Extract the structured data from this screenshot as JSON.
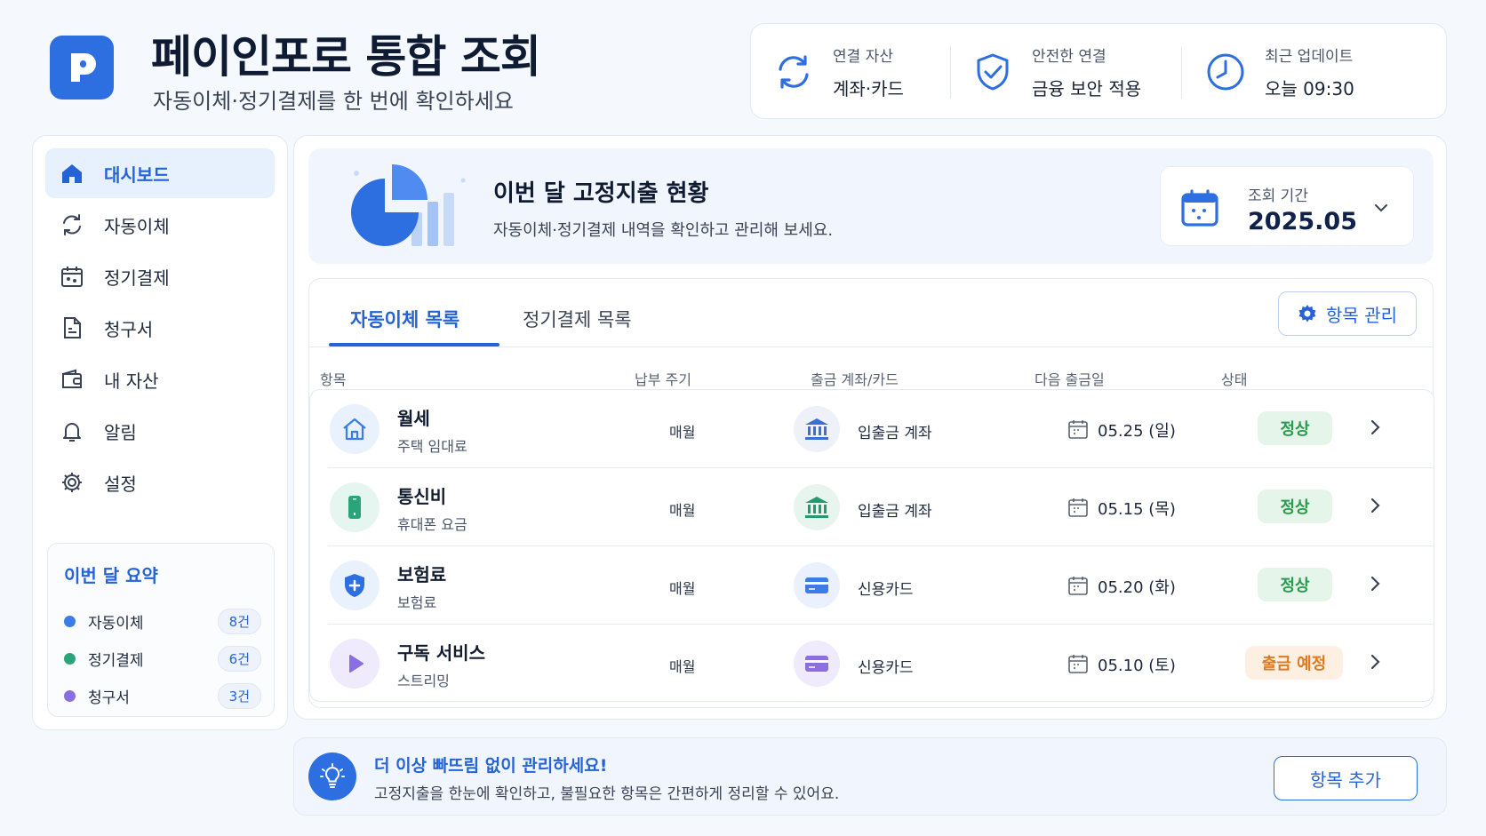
{
  "header": {
    "title": "페이인포로 통합 조회",
    "subtitle": "자동이체·정기결제를 한 번에 확인하세요",
    "logo_letter": "P",
    "stats": [
      {
        "label": "연결 자산",
        "value": "계좌·카드",
        "icon": "sync-icon"
      },
      {
        "label": "안전한 연결",
        "value": "금융 보안 적용",
        "icon": "shield-check-icon"
      },
      {
        "label": "최근 업데이트",
        "value": "오늘 09:30",
        "icon": "clock-icon"
      }
    ]
  },
  "sidebar": {
    "items": [
      {
        "label": "대시보드",
        "icon": "home-icon",
        "active": true
      },
      {
        "label": "자동이체",
        "icon": "refresh-icon"
      },
      {
        "label": "정기결제",
        "icon": "calendar-icon"
      },
      {
        "label": "청구서",
        "icon": "document-icon"
      },
      {
        "label": "내 자산",
        "icon": "wallet-icon"
      },
      {
        "label": "알림",
        "icon": "bell-icon"
      },
      {
        "label": "설정",
        "icon": "gear-icon"
      }
    ],
    "summary": {
      "title": "이번 달 요약",
      "rows": [
        {
          "name": "자동이체",
          "count": "8건",
          "color": "#3b7ce6"
        },
        {
          "name": "정기결제",
          "count": "6건",
          "color": "#2aa57a"
        },
        {
          "name": "청구서",
          "count": "3건",
          "color": "#8b6fe0"
        }
      ]
    }
  },
  "hero": {
    "title": "이번 달 고정지출 현황",
    "desc": "자동이체·정기결제 내역을 확인하고 관리해 보세요.",
    "period_label": "조회 기간",
    "period_value": "2025.05"
  },
  "list": {
    "tabs": [
      "자동이체 목록",
      "정기결제 목록"
    ],
    "manage_label": "항목 관리",
    "columns": [
      "항목",
      "납부 주기",
      "출금 계좌/카드",
      "다음 출금일",
      "상태"
    ],
    "rows": [
      {
        "name": "월세",
        "sub": "주택 임대료",
        "cycle": "매월",
        "account": "입출금 계좌",
        "date": "05.25 (일)",
        "status": "정상",
        "icon": "house-icon",
        "account_icon": "bank-icon"
      },
      {
        "name": "통신비",
        "sub": "휴대폰 요금",
        "cycle": "매월",
        "account": "입출금 계좌",
        "date": "05.15 (목)",
        "status": "정상",
        "icon": "phone-icon",
        "account_icon": "bank-icon"
      },
      {
        "name": "보험료",
        "sub": "보험료",
        "cycle": "매월",
        "account": "신용카드",
        "date": "05.20 (화)",
        "status": "정상",
        "icon": "shield-plus-icon",
        "account_icon": "credit-card-icon"
      },
      {
        "name": "구독 서비스",
        "sub": "스트리밍",
        "cycle": "매월",
        "account": "신용카드",
        "date": "05.10 (토)",
        "status": "출금 예정",
        "icon": "play-icon",
        "account_icon": "credit-card-icon"
      }
    ]
  },
  "banner": {
    "title": "더 이상 빠뜨림 없이 관리하세요!",
    "desc": "고정지출을 한눈에 확인하고, 불필요한 항목은 간편하게 정리할 수 있어요.",
    "button": "항목 추가"
  },
  "colors": {
    "primary": "#2d6fe0",
    "ok": "#2b9b4e",
    "pending": "#e07a1f"
  }
}
